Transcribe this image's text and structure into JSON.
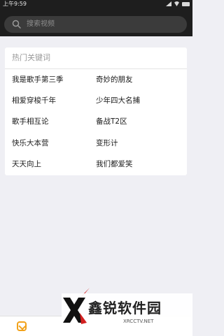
{
  "status_bar": {
    "time": "上午9:59"
  },
  "search": {
    "placeholder": "搜索视频"
  },
  "hot_keywords": {
    "title": "热门关键词",
    "left": [
      "我是歌手第三季",
      "相爱穿梭千年",
      "歌手相互论",
      "快乐大本营",
      "天天向上"
    ],
    "right": [
      "奇妙的朋友",
      "少年四大名捕",
      "备战T2区",
      "变形计",
      "我们都爱笑"
    ]
  },
  "watermark": {
    "title": "鑫锐软件园",
    "subtitle": "XRCCTV.NET"
  },
  "colors": {
    "top_bar": "#1e1e1e",
    "search_box": "#3b3b3b",
    "background": "#efeff4",
    "logo": "#f2a21b"
  },
  "icons": {
    "search": "search-icon",
    "app_logo": "app-logo-icon"
  }
}
